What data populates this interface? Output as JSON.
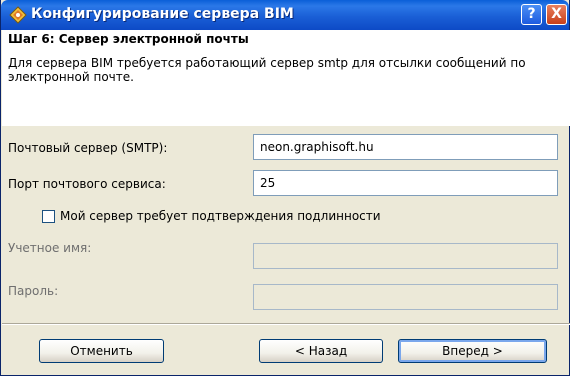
{
  "window": {
    "title": "Конфигурирование сервера BIM",
    "help_label": "?",
    "close_label": "X"
  },
  "step": {
    "title": "Шаг 6: Сервер электронной почты",
    "description": "Для сервера BIM требуется работающий сервер smtp для отсылки сообщений по электронной почте."
  },
  "form": {
    "smtp_label": "Почтовый сервер (SMTP):",
    "smtp_value": "neon.graphisoft.hu",
    "port_label": "Порт почтового сервиса:",
    "port_value": "25",
    "auth_checkbox_label": "Мой сервер требует подтверждения подлинности",
    "auth_checked": false,
    "account_label": "Учетное имя:",
    "account_value": "",
    "password_label": "Пароль:",
    "password_value": ""
  },
  "buttons": {
    "cancel": "Отменить",
    "back": "< Назад",
    "next": "Вперед >"
  },
  "colors": {
    "title_bar": "#1a5fd6",
    "window_bg": "#ece9d8",
    "close_button": "#c8401a"
  }
}
